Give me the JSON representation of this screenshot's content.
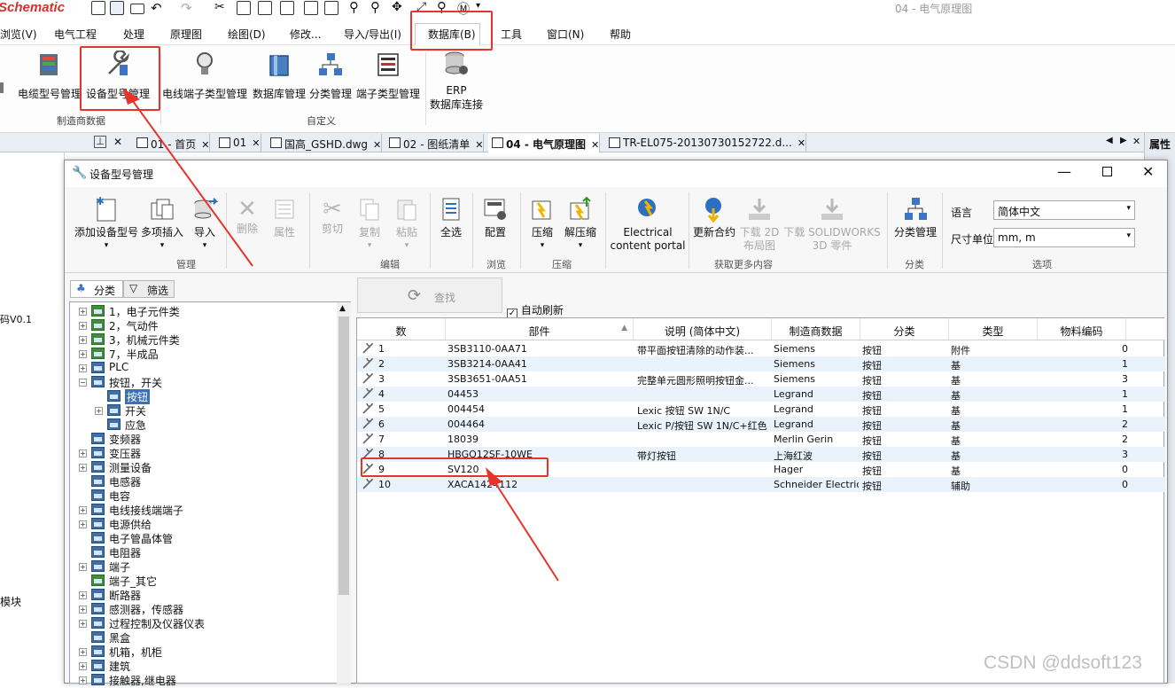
{
  "app": {
    "title": "Schematic",
    "doc_title": "04 - 电气原理图"
  },
  "menu": [
    "浏览(V)",
    "电气工程",
    "处理",
    "原理图",
    "绘图(D)",
    "修改...",
    "导入/导出(I)",
    "数据库(B)",
    "工具",
    "窗口(N)",
    "帮助"
  ],
  "ribbon": {
    "buttons": [
      "电缆型号管理",
      "设备型号管理",
      "电线端子类型管理",
      "数据库管理",
      "分类管理",
      "端子类型管理"
    ],
    "erp": [
      "ERP",
      "数据库连接"
    ],
    "groups": [
      "制造商数据",
      "自定义"
    ]
  },
  "tabs": [
    "01 - 首页",
    "01",
    "国高_GSHD.dwg",
    "02 - 图纸清单",
    "04 - 电气原理图",
    "TR-EL075-20130730152722.d..."
  ],
  "right_panel_label": "属性",
  "left_panel": {
    "text1": "码V0.1",
    "text2": "模块"
  },
  "dialog": {
    "title": "设备型号管理",
    "buttons": {
      "add": "添加设备型号",
      "multi_insert": "多项插入",
      "import": "导入",
      "delete": "删除",
      "properties": "属性",
      "cut": "剪切",
      "copy": "复制",
      "paste": "粘贴",
      "select_all": "全选",
      "config": "配置",
      "compress": "压缩",
      "decompress": "解压缩",
      "content_portal_1": "Electrical",
      "content_portal_2": "content portal",
      "update": "更新合约",
      "download_2d_1": "下载 2D",
      "download_2d_2": "布局图",
      "download_sw_1": "下载 SOLIDWORKS",
      "download_sw_2": "3D 零件",
      "classify_mgmt": "分类管理"
    },
    "groups": {
      "manage": "管理",
      "edit": "编辑",
      "browse": "浏览",
      "compress": "压缩",
      "more": "获取更多内容",
      "classify": "分类",
      "options": "选项"
    },
    "options": {
      "lang_label": "语言",
      "lang_value": "简体中文",
      "unit_label": "尺寸单位",
      "unit_value": "mm, m"
    },
    "tree_tabs": {
      "classify": "分类",
      "filter": "筛选"
    },
    "search_label": "查找",
    "auto_refresh": "自动刷新",
    "tree": [
      {
        "label": "1，电子元件类",
        "level": 0,
        "expander": "+",
        "green": true
      },
      {
        "label": "2，气动件",
        "level": 0,
        "expander": "+",
        "green": true
      },
      {
        "label": "3，机械元件类",
        "level": 0,
        "expander": "+",
        "green": true
      },
      {
        "label": "7，半成品",
        "level": 0,
        "expander": "+",
        "green": true
      },
      {
        "label": "PLC",
        "level": 0,
        "expander": "+"
      },
      {
        "label": "按钮，开关",
        "level": 0,
        "expander": "-"
      },
      {
        "label": "按钮",
        "level": 1,
        "expander": "",
        "selected": true
      },
      {
        "label": "开关",
        "level": 1,
        "expander": "+"
      },
      {
        "label": "应急",
        "level": 1,
        "expander": ""
      },
      {
        "label": "变频器",
        "level": 0,
        "expander": ""
      },
      {
        "label": "变压器",
        "level": 0,
        "expander": "+"
      },
      {
        "label": "测量设备",
        "level": 0,
        "expander": "+"
      },
      {
        "label": "电感器",
        "level": 0,
        "expander": ""
      },
      {
        "label": "电容",
        "level": 0,
        "expander": ""
      },
      {
        "label": "电线接线端端子",
        "level": 0,
        "expander": "+"
      },
      {
        "label": "电源供给",
        "level": 0,
        "expander": "+"
      },
      {
        "label": "电子管晶体管",
        "level": 0,
        "expander": ""
      },
      {
        "label": "电阻器",
        "level": 0,
        "expander": ""
      },
      {
        "label": "端子",
        "level": 0,
        "expander": "+"
      },
      {
        "label": "端子_其它",
        "level": 0,
        "expander": "",
        "green": true
      },
      {
        "label": "断路器",
        "level": 0,
        "expander": "+"
      },
      {
        "label": "感测器，传感器",
        "level": 0,
        "expander": "+"
      },
      {
        "label": "过程控制及仪器仪表",
        "level": 0,
        "expander": "+"
      },
      {
        "label": "黑盒",
        "level": 0,
        "expander": ""
      },
      {
        "label": "机箱，机柜",
        "level": 0,
        "expander": "+"
      },
      {
        "label": "建筑",
        "level": 0,
        "expander": "+"
      },
      {
        "label": "接触器,继电器",
        "level": 0,
        "expander": "+"
      }
    ],
    "table": {
      "headers": [
        "数",
        "部件",
        "说明 (简体中文)",
        "制造商数据",
        "分类",
        "类型",
        "物料编码"
      ],
      "rows": [
        {
          "num": "1",
          "part": "3SB3110-0AA71",
          "desc": "带平面按钮清除的动作装...",
          "mfr": "Siemens",
          "cat": "按钮",
          "type": "附件",
          "code": "0"
        },
        {
          "num": "2",
          "part": "3SB3214-0AA41",
          "desc": "",
          "mfr": "Siemens",
          "cat": "按钮",
          "type": "基",
          "code": "1"
        },
        {
          "num": "3",
          "part": "3SB3651-0AA51",
          "desc": "完整单元圆形照明按钮金...",
          "mfr": "Siemens",
          "cat": "按钮",
          "type": "基",
          "code": "3"
        },
        {
          "num": "4",
          "part": "04453",
          "desc": "",
          "mfr": "Legrand",
          "cat": "按钮",
          "type": "基",
          "code": "1"
        },
        {
          "num": "5",
          "part": "004454",
          "desc": "Lexic 按钮 SW 1N/C",
          "mfr": "Legrand",
          "cat": "按钮",
          "type": "基",
          "code": "1"
        },
        {
          "num": "6",
          "part": "004464",
          "desc": "Lexic P/按钮 SW 1N/C+红色",
          "mfr": "Legrand",
          "cat": "按钮",
          "type": "基",
          "code": "2"
        },
        {
          "num": "7",
          "part": "18039",
          "desc": "",
          "mfr": "Merlin Gerin",
          "cat": "按钮",
          "type": "基",
          "code": "2"
        },
        {
          "num": "8",
          "part": "HBGQ12SF-10WE",
          "desc": "带灯按钮",
          "mfr": "上海红波",
          "cat": "按钮",
          "type": "基",
          "code": "3"
        },
        {
          "num": "9",
          "part": "SV120",
          "desc": "",
          "mfr": "Hager",
          "cat": "按钮",
          "type": "基",
          "code": "0"
        },
        {
          "num": "10",
          "part": "XACA1424112",
          "desc": "",
          "mfr": "Schneider Electric",
          "cat": "按钮",
          "type": "辅助",
          "code": "0"
        }
      ]
    }
  },
  "watermark": "CSDN @ddsoft123",
  "colors": {
    "highlight": "#e8332b",
    "selection": "#3b6fb6",
    "row_alt": "#eaf3fb"
  }
}
